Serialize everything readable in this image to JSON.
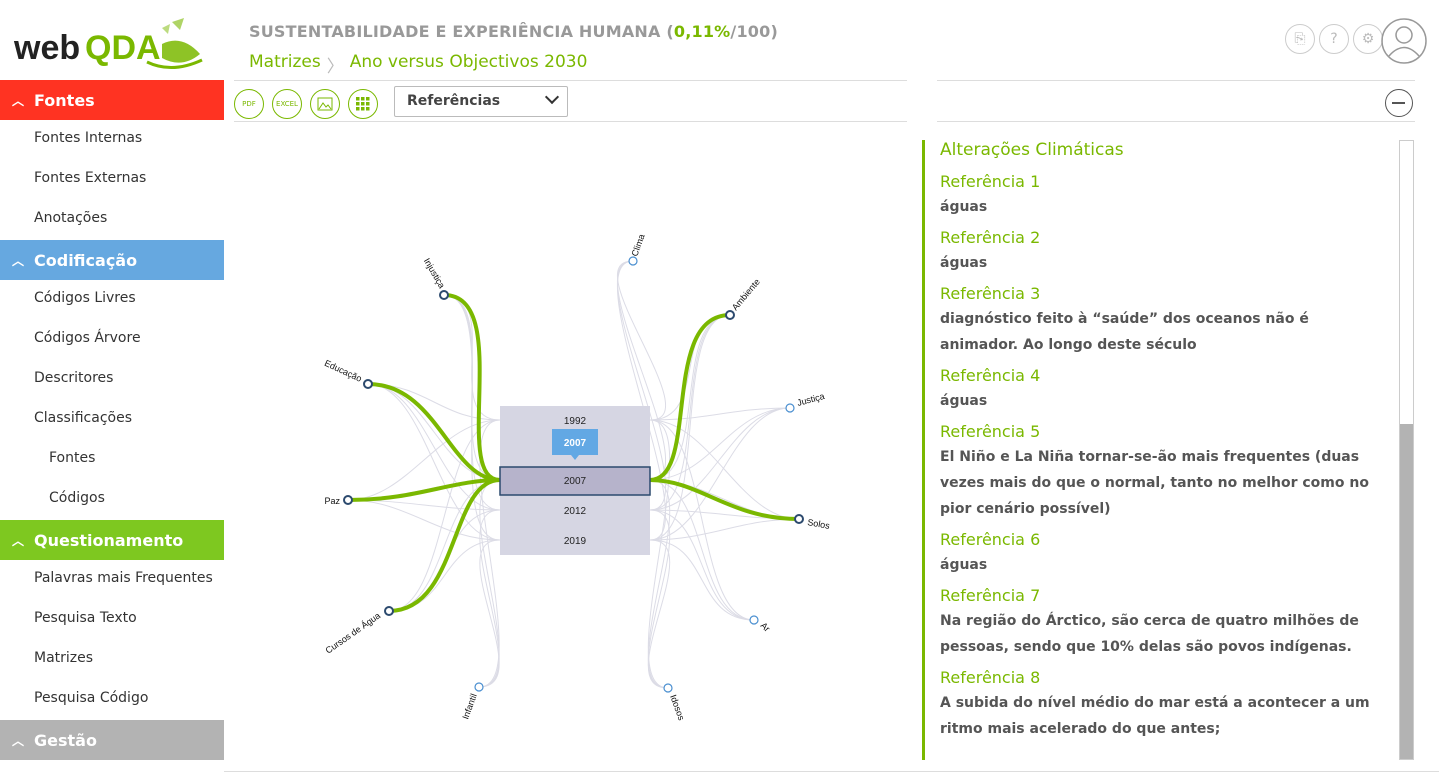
{
  "logo": {
    "text_web": "web",
    "text_qda": "QDA"
  },
  "sidebar": {
    "fontes": {
      "label": "Fontes",
      "color": "#ff3322",
      "items": [
        "Fontes Internas",
        "Fontes Externas",
        "Anotações"
      ]
    },
    "codificacao": {
      "label": "Codificação",
      "color": "#66a8e0",
      "items": [
        "Códigos Livres",
        "Códigos Árvore",
        "Descritores",
        "Classificações"
      ],
      "subitems": [
        "Fontes",
        "Códigos"
      ]
    },
    "questionamento": {
      "label": "Questionamento",
      "color": "#7ec820",
      "items": [
        "Palavras mais Frequentes",
        "Pesquisa Texto",
        "Matrizes",
        "Pesquisa Código"
      ]
    },
    "gestao": {
      "label": "Gestão",
      "color": "#b3b3b3"
    }
  },
  "header": {
    "project": "SUSTENTABILIDADE E EXPERIÊNCIA HUMANA",
    "pct_open": " (",
    "pct": "0,11%",
    "pct_close": "/100)",
    "breadcrumb": [
      "Matrizes",
      "Ano versus Objectivos 2030"
    ]
  },
  "toolbar": {
    "pdf": "PDF",
    "excel": "EXCEL",
    "select_value": "Referências"
  },
  "chart_data": {
    "type": "chord-bundle",
    "center_years": [
      "1992",
      "2007",
      "2007",
      "2012",
      "2019"
    ],
    "tooltip": "2007",
    "selected_year": "2007",
    "nodes": [
      "Clima",
      "Ambiente",
      "Justiça",
      "Solos",
      "Ar",
      "Idosos",
      "Infantil",
      "Cursos de Água",
      "Paz",
      "Educação",
      "Injustiça"
    ],
    "highlighted_nodes": [
      "Ambiente",
      "Solos",
      "Cursos de Água",
      "Paz",
      "Educação",
      "Injustiça"
    ],
    "accent": "#7ab800"
  },
  "panel": {
    "title": "Alterações Climáticas",
    "refs": [
      {
        "title": "Referência 1",
        "text": "águas"
      },
      {
        "title": "Referência 2",
        "text": "águas"
      },
      {
        "title": "Referência 3",
        "text": "diagnóstico feito à “saúde” dos oceanos não é animador. Ao longo deste século"
      },
      {
        "title": "Referência 4",
        "text": "águas"
      },
      {
        "title": "Referência 5",
        "text": "El Niño e La Niña tornar-se-ão mais frequentes (duas vezes mais do que o normal, tanto no melhor como no pior cenário possível)"
      },
      {
        "title": "Referência 6",
        "text": "águas"
      },
      {
        "title": "Referência 7",
        "text": "Na região do Árctico, são cerca de quatro milhões de pessoas, sendo que 10% delas são povos indígenas."
      },
      {
        "title": "Referência 8",
        "text": "A subida do nível médio do mar está a acontecer a um ritmo mais acelerado do que antes;"
      }
    ]
  }
}
